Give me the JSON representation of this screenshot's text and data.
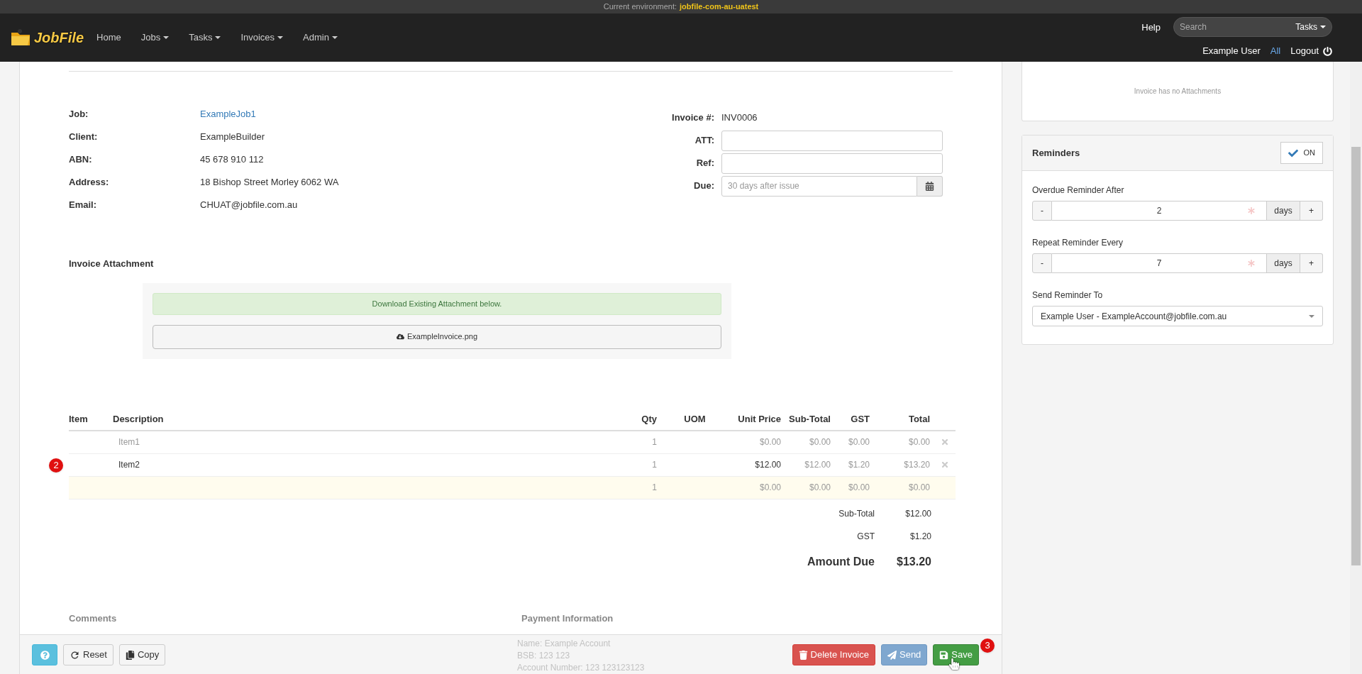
{
  "environment": {
    "label": "Current environment:",
    "value": "jobfile-com-au-uatest"
  },
  "nav": {
    "logo": "JobFile",
    "items": [
      {
        "label": "Home",
        "dropdown": false
      },
      {
        "label": "Jobs",
        "dropdown": true
      },
      {
        "label": "Tasks",
        "dropdown": true
      },
      {
        "label": "Invoices",
        "dropdown": true
      },
      {
        "label": "Admin",
        "dropdown": true
      }
    ],
    "help": "Help",
    "search": {
      "placeholder": "Search",
      "scope": "Tasks"
    },
    "user": "Example User",
    "all": "All",
    "logout": "Logout"
  },
  "details": [
    {
      "label": "Job:",
      "value": "ExampleJob1",
      "kind": "link"
    },
    {
      "label": "Client:",
      "value": "ExampleBuilder",
      "kind": "text"
    },
    {
      "label": "ABN:",
      "value": "45 678 910 112",
      "kind": "text"
    },
    {
      "label": "Address:",
      "value": "18 Bishop Street Morley 6062 WA",
      "kind": "text"
    },
    {
      "label": "Email:",
      "value": "CHUAT@jobfile.com.au",
      "kind": "text"
    }
  ],
  "invoice_fields": [
    {
      "label": "Invoice #:",
      "kind": "text",
      "value": "INV0006"
    },
    {
      "label": "ATT:",
      "kind": "input"
    },
    {
      "label": "Ref:",
      "kind": "input"
    },
    {
      "label": "Due:",
      "kind": "date",
      "placeholder": "30 days after issue"
    }
  ],
  "attachment": {
    "title": "Invoice Attachment",
    "notice": "Download Existing Attachment below.",
    "file": "ExampleInvoice.png"
  },
  "table": {
    "columns": [
      "Item",
      "Description",
      "Qty",
      "UOM",
      "Unit Price",
      "Sub-Total",
      "GST",
      "Total"
    ],
    "rows": [
      {
        "kind": "placeholder",
        "description": "Item1",
        "qty": "1",
        "unit_price": "$0.00",
        "sub_total": "$0.00",
        "gst": "$0.00",
        "total": "$0.00"
      },
      {
        "kind": "filled",
        "description": "Item2",
        "qty": "1",
        "unit_price": "$12.00",
        "sub_total": "$12.00",
        "gst": "$1.20",
        "total": "$13.20",
        "marker": "2"
      },
      {
        "kind": "new",
        "qty": "1",
        "unit_price": "$0.00",
        "sub_total": "$0.00",
        "gst": "$0.00",
        "total": "$0.00"
      }
    ]
  },
  "totals": [
    {
      "label": "Sub-Total",
      "value": "$12.00",
      "kind": "normal"
    },
    {
      "label": "GST",
      "value": "$1.20",
      "kind": "normal"
    },
    {
      "label": "Amount Due",
      "value": "$13.20",
      "kind": "grand"
    }
  ],
  "comments_title": "Comments",
  "payment": {
    "title": "Payment Information",
    "lines": [
      "Name: Example Account",
      "BSB: 123 123",
      "Account Number: 123 123123123"
    ]
  },
  "actions_left": [
    {
      "kind": "help"
    },
    {
      "label": "Reset",
      "kind": "reset"
    },
    {
      "label": "Copy",
      "kind": "copy"
    }
  ],
  "actions_right": [
    {
      "label": "Delete Invoice",
      "kind": "delete"
    },
    {
      "label": "Send",
      "kind": "send"
    },
    {
      "label": "Save",
      "kind": "save",
      "marker": "3"
    }
  ],
  "attachments_panel": {
    "empty": "Invoice has no Attachments"
  },
  "reminders": {
    "title": "Reminders",
    "toggle": {
      "label": "ON",
      "on": true
    },
    "steppers": [
      {
        "label": "Overdue Reminder After",
        "value": "2",
        "unit": "days",
        "minus": "-",
        "plus": "+"
      },
      {
        "label": "Repeat Reminder Every",
        "value": "7",
        "unit": "days",
        "minus": "-",
        "plus": "+"
      }
    ],
    "recipient": {
      "label": "Send Reminder To",
      "value": "Example User - ExampleAccount@jobfile.com.au"
    }
  }
}
